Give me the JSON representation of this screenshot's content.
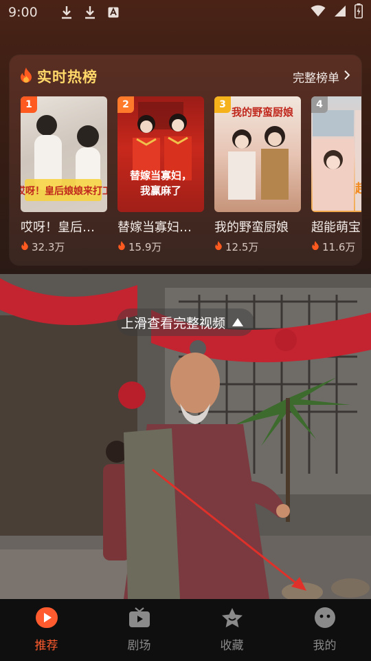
{
  "status_bar": {
    "time": "9:00"
  },
  "hot_list": {
    "title": "实时热榜",
    "full_list_label": "完整榜单",
    "items": [
      {
        "rank": "1",
        "name": "哎呀！皇后…",
        "heat": "32.3万",
        "cover_text": "哎呀！皇后娘娘来打工"
      },
      {
        "rank": "2",
        "name": "替嫁当寡妇…",
        "heat": "15.9万",
        "cover_text": "替嫁当寡妇，我赢麻了"
      },
      {
        "rank": "3",
        "name": "我的野蛮厨娘",
        "heat": "12.5万",
        "cover_text": "我的野蛮厨娘"
      },
      {
        "rank": "4",
        "name": "超能萌宝",
        "heat": "11.6万",
        "cover_text": "超能萌宝"
      }
    ]
  },
  "video": {
    "swipe_hint": "上滑查看完整视频"
  },
  "bottom_nav": {
    "items": [
      {
        "label": "推荐",
        "icon": "play-circle-icon"
      },
      {
        "label": "剧场",
        "icon": "tv-icon"
      },
      {
        "label": "收藏",
        "icon": "star-icon"
      },
      {
        "label": "我的",
        "icon": "profile-icon"
      }
    ]
  },
  "colors": {
    "accent": "#ff5b2e",
    "title_gold": "#ffd86a",
    "rank_1": "#ff5a1f",
    "rank_2": "#ff7a2a",
    "rank_3": "#f6b21b",
    "rank_4": "#9a9a9a"
  }
}
